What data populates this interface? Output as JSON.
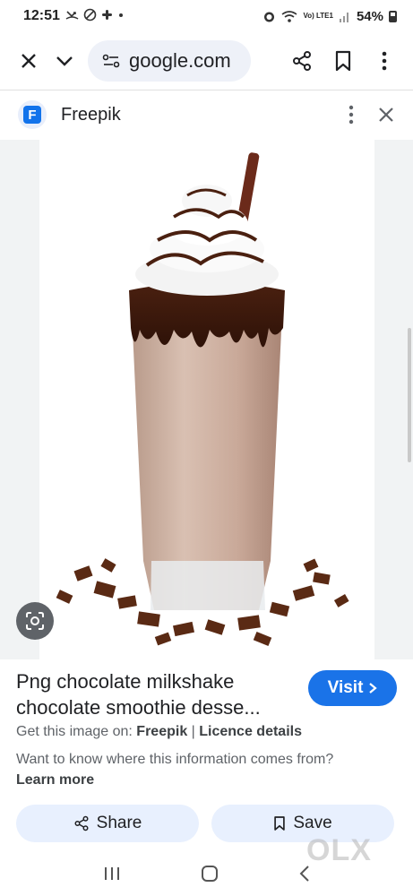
{
  "status": {
    "time": "12:51",
    "signal_text": "Vo) LTE1",
    "battery": "54%"
  },
  "browser": {
    "url": "google.com",
    "icons": [
      "close-icon",
      "chevron-down-icon",
      "site-settings-icon",
      "share-icon",
      "bookmark-icon",
      "more-vert-icon"
    ]
  },
  "source": {
    "logo_letter": "F",
    "name": "Freepik"
  },
  "image": {
    "alt": "Png chocolate milkshake chocolate smoothie dessert"
  },
  "caption": {
    "title_line1": "Png chocolate milkshake",
    "title_line2": "chocolate smoothie desse...",
    "visit_label": "Visit",
    "get_image_prefix": "Get this image on: ",
    "get_image_source": "Freepik",
    "separator": " | ",
    "licence": "Licence details",
    "info_text": "Want to know where this information comes from? ",
    "learn_more": "Learn more"
  },
  "actions": {
    "share_label": "Share",
    "save_label": "Save"
  },
  "watermark": "OLX",
  "colors": {
    "accent": "#1a73e8",
    "pill_bg": "#e8f0fe",
    "url_bg": "#eef1f8",
    "freepik_blue": "#1273eb"
  }
}
